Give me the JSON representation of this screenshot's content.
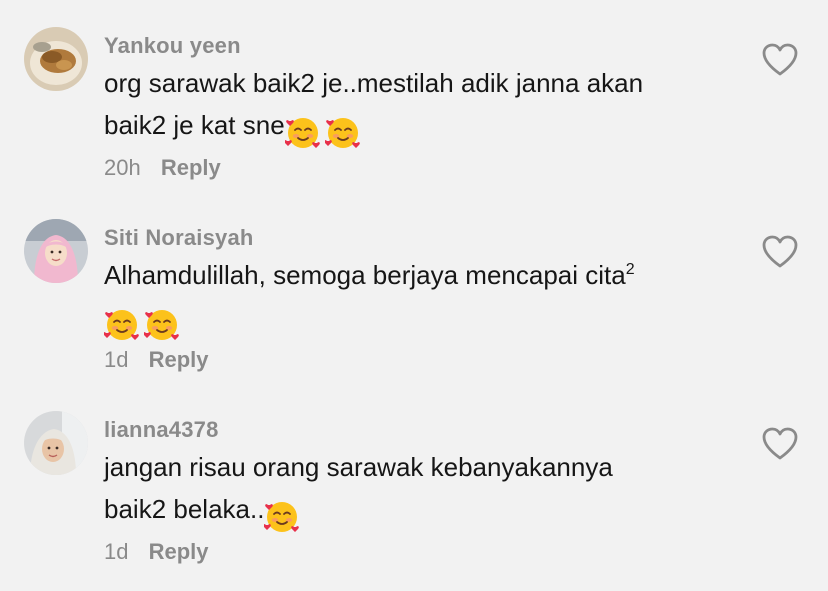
{
  "comments": [
    {
      "username": "Yankou yeen",
      "text_lines": [
        "org sarawak baik2 je..mestilah adik janna akan",
        "baik2 je kat sne"
      ],
      "emoji_name": "smiling-face-with-hearts",
      "emoji_count": 2,
      "time": "20h",
      "reply_label": "Reply",
      "avatar": "food-photo-avatar"
    },
    {
      "username": "Siti Noraisyah",
      "text_lines": [
        "Alhamdulillah, semoga berjaya mencapai cita"
      ],
      "superscript": "2",
      "emoji_name": "smiling-face-with-hearts",
      "emoji_count": 2,
      "time": "1d",
      "reply_label": "Reply",
      "avatar": "hijab-portrait-avatar"
    },
    {
      "username": "lianna4378",
      "text_lines": [
        "jangan risau orang sarawak kebanyakannya",
        "baik2 belaka.."
      ],
      "emoji_name": "smiling-face-with-hearts",
      "emoji_count": 1,
      "time": "1d",
      "reply_label": "Reply",
      "avatar": "selfie-portrait-avatar"
    }
  ],
  "colors": {
    "background": "#f2f2f2",
    "text": "#161616",
    "muted": "#8a8a8a",
    "heart_outline": "#8a8a8a"
  }
}
